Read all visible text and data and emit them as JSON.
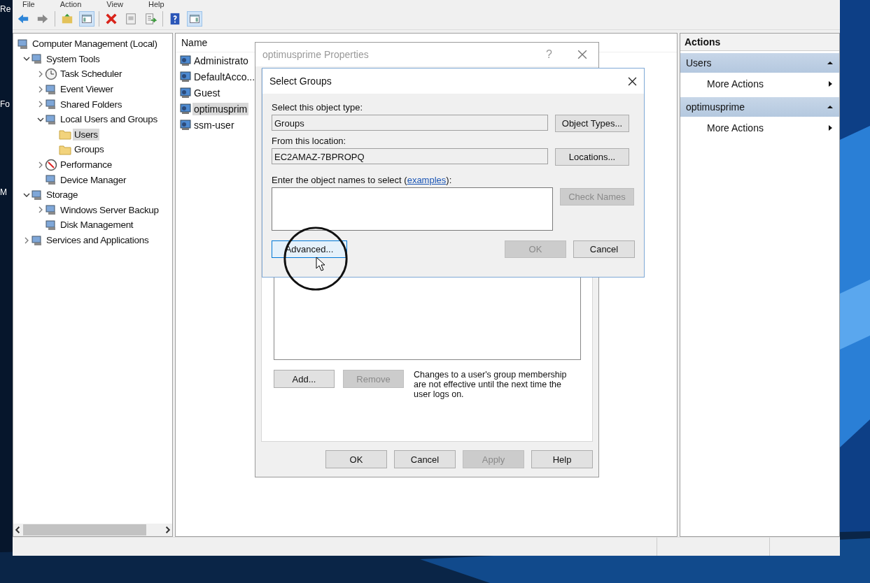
{
  "desktop_icons": [
    "Re",
    "Fo",
    "M"
  ],
  "menu": [
    "File",
    "Action",
    "View",
    "Help"
  ],
  "tree": [
    {
      "label": "Computer Management (Local)",
      "selected": false,
      "children": [
        {
          "label": "System Tools",
          "expanded": true,
          "selected": false,
          "children": [
            {
              "label": "Task Scheduler",
              "expanded": false,
              "selected": false
            },
            {
              "label": "Event Viewer",
              "expanded": false,
              "selected": false
            },
            {
              "label": "Shared Folders",
              "expanded": false,
              "selected": false
            },
            {
              "label": "Local Users and Groups",
              "expanded": true,
              "selected": false,
              "children": [
                {
                  "label": "Users",
                  "selected": true
                },
                {
                  "label": "Groups",
                  "selected": false
                }
              ]
            },
            {
              "label": "Performance",
              "expanded": false,
              "selected": false
            },
            {
              "label": "Device Manager",
              "selected": false
            }
          ]
        },
        {
          "label": "Storage",
          "expanded": true,
          "selected": false,
          "children": [
            {
              "label": "Windows Server Backup",
              "expanded": false,
              "selected": false
            },
            {
              "label": "Disk Management",
              "selected": false
            }
          ]
        },
        {
          "label": "Services and Applications",
          "expanded": false,
          "selected": false
        }
      ]
    }
  ],
  "list": {
    "columns": [
      "Name"
    ],
    "rows": [
      {
        "name": "Administrato",
        "selected": false
      },
      {
        "name": "DefaultAcco...",
        "selected": false
      },
      {
        "name": "Guest",
        "selected": false
      },
      {
        "name": "optimusprim",
        "selected": true
      },
      {
        "name": "ssm-user",
        "selected": false
      }
    ]
  },
  "actions": {
    "title": "Actions",
    "sections": [
      {
        "title": "Users",
        "expanded": true,
        "items": [
          "More Actions"
        ]
      },
      {
        "title": "optimusprime",
        "expanded": true,
        "items": [
          "More Actions"
        ]
      }
    ]
  },
  "properties": {
    "title": "optimusprime Properties",
    "help": "?",
    "buttons": [
      {
        "label": "Add...",
        "disabled": false
      },
      {
        "label": "Remove",
        "disabled": true
      }
    ],
    "note": "Changes to a user's group membership are not effective until the next time the user logs on.",
    "footer": [
      {
        "label": "OK",
        "disabled": false
      },
      {
        "label": "Cancel",
        "disabled": false
      },
      {
        "label": "Apply",
        "disabled": true
      },
      {
        "label": "Help",
        "disabled": false
      }
    ]
  },
  "select_groups": {
    "title": "Select Groups",
    "object_type": {
      "label": "Select this object type:",
      "value": "Groups",
      "button": "Object Types..."
    },
    "location": {
      "label": "From this location:",
      "value": "EC2AMAZ-7BPROPQ",
      "button": "Locations..."
    },
    "names": {
      "label_before": "Enter the object names to select (",
      "link": "examples",
      "label_after": "):",
      "check_button": {
        "label": "Check Names",
        "disabled": true
      }
    },
    "advanced": {
      "label": "Advanced...",
      "hovered": true
    },
    "footer": [
      {
        "label": "OK",
        "disabled": true
      },
      {
        "label": "Cancel",
        "disabled": false
      }
    ]
  }
}
